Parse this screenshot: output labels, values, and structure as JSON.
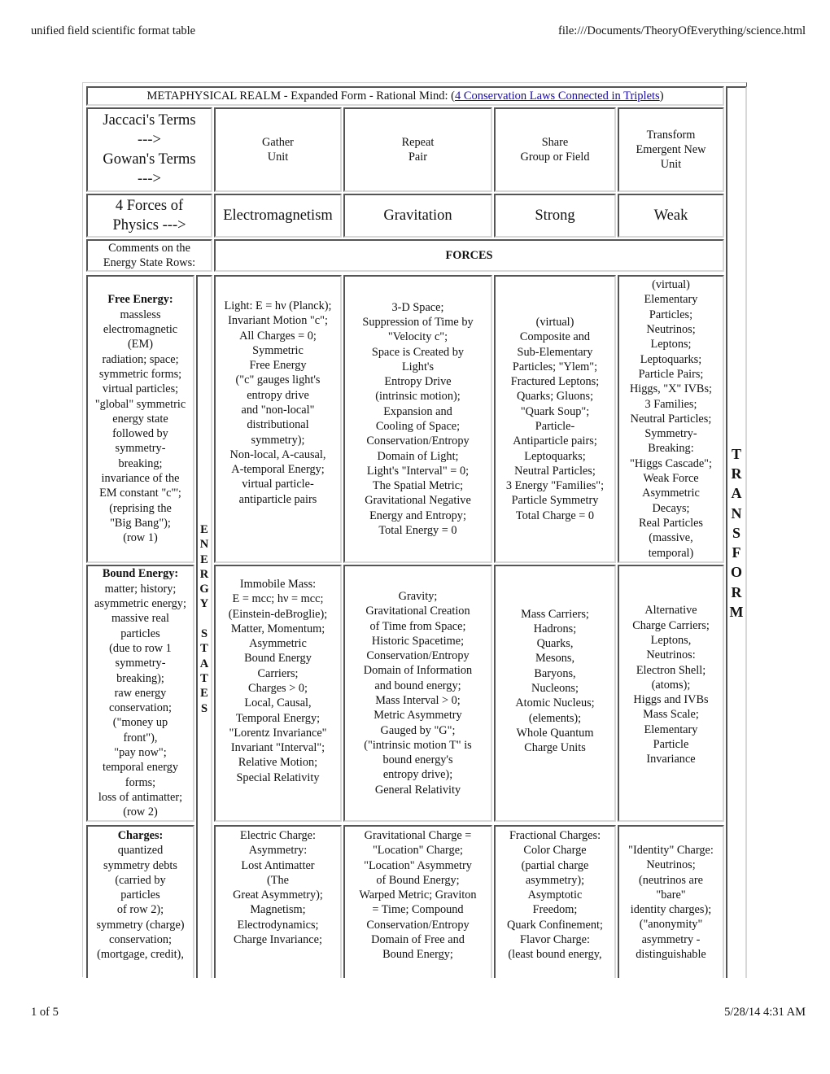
{
  "page_header": {
    "title": "unified field scientific format table",
    "url": "file:///Documents/TheoryOfEverything/science.html"
  },
  "page_footer": {
    "page": "1 of 5",
    "timestamp": "5/28/14 4:31 AM"
  },
  "table": {
    "caption_prefix": "METAPHYSICAL REALM - Expanded Form - Rational Mind: (",
    "caption_link": "4 Conservation Laws Connected in Triplets",
    "caption_suffix": ")",
    "terms_label": "Jaccaci's Terms\n--->\nGowan's Terms\n--->",
    "terms": [
      "Gather\nUnit",
      "Repeat\nPair",
      "Share\nGroup or Field",
      "Transform\nEmergent New\nUnit"
    ],
    "forces_label": "4 Forces of\nPhysics --->",
    "forces": [
      "Electromagnetism",
      "Gravitation",
      "Strong",
      "Weak"
    ],
    "comments_label": "Comments on the\nEnergy State Rows:",
    "forces_header": "FORCES",
    "energy_states_letters": [
      "E",
      "N",
      "E",
      "R",
      "G",
      "Y",
      " ",
      "S",
      "T",
      "A",
      "T",
      "E",
      "S"
    ],
    "transform_letters": [
      "T",
      "R",
      "A",
      "N",
      "S",
      "F",
      "O",
      "R",
      "M"
    ],
    "rows": [
      {
        "comment_title": "Free Energy:",
        "comment": "massless\nelectromagnetic\n(EM)\nradiation; space;\nsymmetric forms;\nvirtual particles;\n\"global\" symmetric\nenergy state\nfollowed by\nsymmetry-\nbreaking;\ninvariance of the\nEM constant \"c\"';\n(reprising the\n\"Big Bang\");\n(row 1)",
        "cells": [
          "Light: E = hν (Planck);\nInvariant Motion \"c\";\nAll Charges = 0;\nSymmetric\nFree Energy\n(\"c\" gauges light's\nentropy drive\nand \"non-local\"\ndistributional\nsymmetry);\nNon-local, A-causal,\nA-temporal Energy;\nvirtual particle-\nantiparticle pairs",
          "3-D Space;\nSuppression of Time by\n\"Velocity c\";\nSpace is Created by\nLight's\nEntropy Drive\n(intrinsic motion);\nExpansion and\nCooling of Space;\nConservation/Entropy\nDomain of Light;\nLight's \"Interval\" = 0;\nThe Spatial Metric;\nGravitational Negative\nEnergy and Entropy;\nTotal Energy = 0",
          "(virtual)\nComposite and\nSub-Elementary\nParticles; \"Ylem\";\nFractured Leptons;\nQuarks; Gluons;\n\"Quark Soup\";\nParticle-\nAntiparticle pairs;\nLeptoquarks;\nNeutral Particles;\n3 Energy \"Families\";\nParticle Symmetry\nTotal Charge = 0",
          "(virtual)\nElementary\nParticles;\nNeutrinos;\nLeptons;\nLeptoquarks;\nParticle Pairs;\nHiggs, \"X\" IVBs;\n3 Families;\nNeutral Particles;\nSymmetry-\nBreaking:\n\"Higgs Cascade\";\nWeak Force\nAsymmetric\nDecays;\nReal Particles\n(massive,\ntemporal)"
        ]
      },
      {
        "comment_title": "Bound Energy:",
        "comment": "matter; history;\nasymmetric energy;\nmassive real\nparticles\n(due to row 1\nsymmetry-\nbreaking);\nraw energy\nconservation;\n(\"money up\nfront\"),\n\"pay now\";\ntemporal energy\nforms;\nloss of antimatter;\n(row 2)",
        "cells": [
          "Immobile Mass:\nE = mcc; hν = mcc;\n(Einstein-deBroglie);\nMatter, Momentum;\nAsymmetric\nBound Energy\nCarriers;\nCharges > 0;\nLocal, Causal,\nTemporal Energy;\n\"Lorentz Invariance\"\nInvariant \"Interval\";\nRelative Motion;\nSpecial Relativity",
          "Gravity;\nGravitational Creation\nof Time from Space;\nHistoric Spacetime;\nConservation/Entropy\nDomain of Information\nand bound energy;\nMass Interval > 0;\nMetric Asymmetry\nGauged by \"G\";\n(\"intrinsic motion T\" is\nbound energy's\nentropy drive);\nGeneral Relativity",
          "Mass Carriers;\nHadrons;\nQuarks,\nMesons,\nBaryons,\nNucleons;\nAtomic Nucleus;\n(elements);\nWhole Quantum\nCharge Units",
          "Alternative\nCharge Carriers;\nLeptons,\nNeutrinos:\nElectron Shell;\n(atoms);\nHiggs and IVBs\nMass Scale;\nElementary\nParticle\nInvariance"
        ]
      },
      {
        "comment_title": "Charges:",
        "comment": "quantized\nsymmetry debts\n(carried by\nparticles\nof row 2);\nsymmetry (charge)\nconservation;\n(mortgage, credit),",
        "cells": [
          "Electric Charge:\nAsymmetry:\nLost Antimatter\n(The\nGreat Asymmetry);\nMagnetism;\nElectrodynamics;\nCharge Invariance;",
          "Gravitational Charge =\n\"Location\" Charge;\n\"Location\" Asymmetry\nof Bound Energy;\nWarped Metric; Graviton\n= Time; Compound\nConservation/Entropy\nDomain of Free and\nBound Energy;",
          "Fractional Charges:\nColor Charge\n(partial charge\nasymmetry);\nAsymptotic\nFreedom;\nQuark Confinement;\nFlavor Charge:\n(least bound energy,",
          "\"Identity\" Charge:\nNeutrinos;\n(neutrinos are\n\"bare\"\nidentity charges);\n(\"anonymity\"\nasymmetry -\ndistinguishable"
        ]
      }
    ]
  }
}
